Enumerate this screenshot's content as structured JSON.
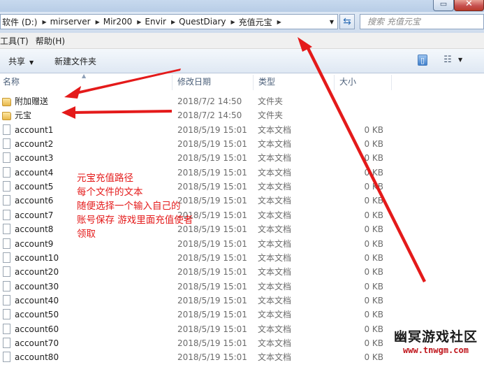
{
  "address_bar": {
    "breadcrumbs": [
      "软件 (D:)",
      "mirserver",
      "Mir200",
      "Envir",
      "QuestDiary",
      "充值元宝"
    ],
    "search_placeholder": "搜索 充值元宝"
  },
  "menu": {
    "items": [
      "工具(T)",
      "帮助(H)"
    ]
  },
  "toolbar": {
    "share_label": "共享",
    "new_folder_label": "新建文件夹"
  },
  "columns": {
    "name": "名称",
    "date": "修改日期",
    "type": "类型",
    "size": "大小"
  },
  "files": [
    {
      "name": "附加赠送",
      "date": "2018/7/2 14:50",
      "type": "文件夹",
      "size": "",
      "kind": "folder"
    },
    {
      "name": "元宝",
      "date": "2018/7/2 14:50",
      "type": "文件夹",
      "size": "",
      "kind": "folder"
    },
    {
      "name": "account1",
      "date": "2018/5/19 15:01",
      "type": "文本文档",
      "size": "0 KB",
      "kind": "doc"
    },
    {
      "name": "account2",
      "date": "2018/5/19 15:01",
      "type": "文本文档",
      "size": "0 KB",
      "kind": "doc"
    },
    {
      "name": "account3",
      "date": "2018/5/19 15:01",
      "type": "文本文档",
      "size": "0 KB",
      "kind": "doc"
    },
    {
      "name": "account4",
      "date": "2018/5/19 15:01",
      "type": "文本文档",
      "size": "0 KB",
      "kind": "doc"
    },
    {
      "name": "account5",
      "date": "2018/5/19 15:01",
      "type": "文本文档",
      "size": "0 KB",
      "kind": "doc"
    },
    {
      "name": "account6",
      "date": "2018/5/19 15:01",
      "type": "文本文档",
      "size": "0 KB",
      "kind": "doc"
    },
    {
      "name": "account7",
      "date": "2018/5/19 15:01",
      "type": "文本文档",
      "size": "0 KB",
      "kind": "doc"
    },
    {
      "name": "account8",
      "date": "2018/5/19 15:01",
      "type": "文本文档",
      "size": "0 KB",
      "kind": "doc"
    },
    {
      "name": "account9",
      "date": "2018/5/19 15:01",
      "type": "文本文档",
      "size": "0 KB",
      "kind": "doc"
    },
    {
      "name": "account10",
      "date": "2018/5/19 15:01",
      "type": "文本文档",
      "size": "0 KB",
      "kind": "doc"
    },
    {
      "name": "account20",
      "date": "2018/5/19 15:01",
      "type": "文本文档",
      "size": "0 KB",
      "kind": "doc"
    },
    {
      "name": "account30",
      "date": "2018/5/19 15:01",
      "type": "文本文档",
      "size": "0 KB",
      "kind": "doc"
    },
    {
      "name": "account40",
      "date": "2018/5/19 15:01",
      "type": "文本文档",
      "size": "0 KB",
      "kind": "doc"
    },
    {
      "name": "account50",
      "date": "2018/5/19 15:01",
      "type": "文本文档",
      "size": "0 KB",
      "kind": "doc"
    },
    {
      "name": "account60",
      "date": "2018/5/19 15:01",
      "type": "文本文档",
      "size": "0 KB",
      "kind": "doc"
    },
    {
      "name": "account70",
      "date": "2018/5/19 15:01",
      "type": "文本文档",
      "size": "0 KB",
      "kind": "doc"
    },
    {
      "name": "account80",
      "date": "2018/5/19 15:01",
      "type": "文本文档",
      "size": "0 KB",
      "kind": "doc"
    }
  ],
  "annotation": {
    "lines": [
      "元宝充值路径",
      "每个文件的文本",
      "随便选择一个输入自己的",
      "账号保存  游戏里面充值使者",
      "领取"
    ],
    "color": "#e41a1a"
  },
  "watermark": {
    "title": "幽冥游戏社区",
    "url": "www.tnwgm.com"
  }
}
